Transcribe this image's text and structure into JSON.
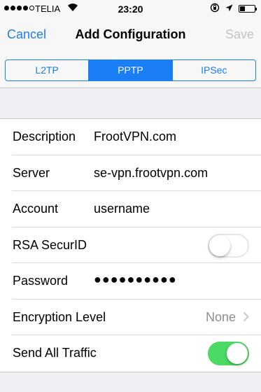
{
  "status_bar": {
    "carrier": "TELIA",
    "time": "23:20"
  },
  "nav": {
    "cancel_label": "Cancel",
    "title": "Add Configuration",
    "save_label": "Save"
  },
  "segments": {
    "items": [
      "L2TP",
      "PPTP",
      "IPSec"
    ],
    "selected": "PPTP"
  },
  "form": {
    "description": {
      "label": "Description",
      "value": "FrootVPN.com"
    },
    "server": {
      "label": "Server",
      "value": "se-vpn.frootvpn.com"
    },
    "account": {
      "label": "Account",
      "value": "username"
    },
    "rsa": {
      "label": "RSA SecurID",
      "on": false
    },
    "password": {
      "label": "Password",
      "value": "●●●●●●●●●●"
    },
    "encryption": {
      "label": "Encryption Level",
      "value": "None"
    },
    "send_all": {
      "label": "Send All Traffic",
      "on": true
    }
  },
  "colors": {
    "accent": "#1a7ef5",
    "toggle_on": "#4cd964",
    "disabled": "#c4c4c9"
  }
}
